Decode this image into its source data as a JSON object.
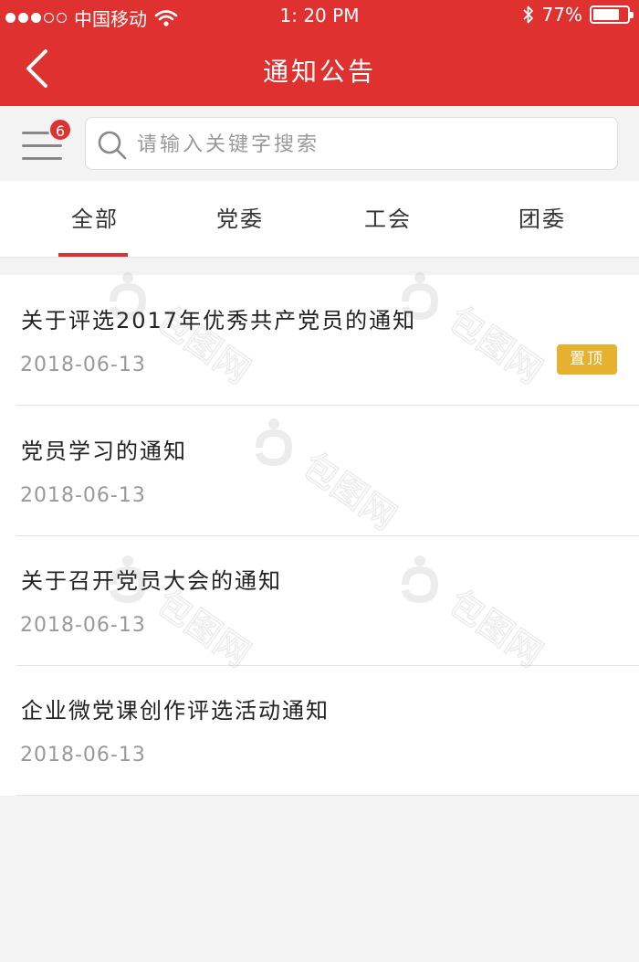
{
  "status_bar": {
    "carrier": "中国移动",
    "time": "1: 20 PM",
    "battery": "77%",
    "battery_level": 0.77
  },
  "nav": {
    "title": "通知公告"
  },
  "search": {
    "placeholder": "请输入关键字搜索",
    "menu_badge": "6"
  },
  "tabs": [
    {
      "label": "全部",
      "active": true
    },
    {
      "label": "党委",
      "active": false
    },
    {
      "label": "工会",
      "active": false
    },
    {
      "label": "团委",
      "active": false
    }
  ],
  "notices": [
    {
      "title": "关于评选2017年优秀共产党员的通知",
      "date": "2018-06-13",
      "pinned": true,
      "pin_label": "置顶"
    },
    {
      "title": "党员学习的通知",
      "date": "2018-06-13",
      "pinned": false
    },
    {
      "title": "关于召开党员大会的通知",
      "date": "2018-06-13",
      "pinned": false
    },
    {
      "title": "企业微党课创作评选活动通知",
      "date": "2018-06-13",
      "pinned": false
    }
  ],
  "watermark_text": "包图网",
  "colors": {
    "brand_red": "#e03131",
    "pin_yellow": "#e5b12e",
    "background": "#f3f3f3"
  }
}
